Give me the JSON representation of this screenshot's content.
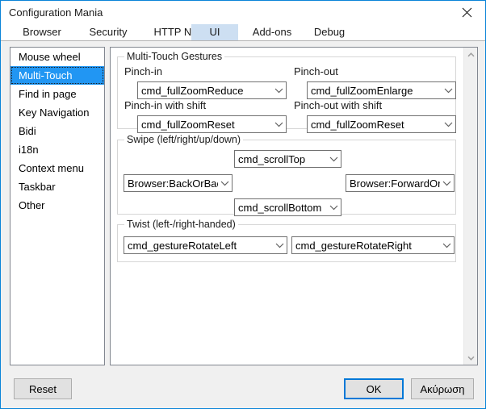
{
  "window": {
    "title": "Configuration Mania",
    "close_icon": "close-icon"
  },
  "tabs": [
    {
      "label": "Browser",
      "selected": false
    },
    {
      "label": "Security",
      "selected": false
    },
    {
      "label": "HTTP Network",
      "selected": false
    },
    {
      "label": "UI",
      "selected": true
    },
    {
      "label": "Add-ons",
      "selected": false
    },
    {
      "label": "Debug",
      "selected": false
    }
  ],
  "sidebar": {
    "items": [
      {
        "label": "Mouse wheel",
        "selected": false
      },
      {
        "label": "Multi-Touch",
        "selected": true
      },
      {
        "label": "Find in page",
        "selected": false
      },
      {
        "label": "Key Navigation",
        "selected": false
      },
      {
        "label": "Bidi",
        "selected": false
      },
      {
        "label": "i18n",
        "selected": false
      },
      {
        "label": "Context menu",
        "selected": false
      },
      {
        "label": "Taskbar",
        "selected": false
      },
      {
        "label": "Other",
        "selected": false
      }
    ]
  },
  "main": {
    "groups": {
      "gestures": {
        "title": "Multi-Touch Gestures",
        "fields": {
          "pinch_in": {
            "label": "Pinch-in",
            "value": "cmd_fullZoomReduce"
          },
          "pinch_out": {
            "label": "Pinch-out",
            "value": "cmd_fullZoomEnlarge"
          },
          "pinch_in_shift": {
            "label": "Pinch-in with shift",
            "value": "cmd_fullZoomReset"
          },
          "pinch_out_shift": {
            "label": "Pinch-out with shift",
            "value": "cmd_fullZoomReset"
          }
        }
      },
      "swipe": {
        "title": "Swipe (left/right/up/down)",
        "fields": {
          "up": {
            "value": "cmd_scrollTop"
          },
          "left": {
            "value": "Browser:BackOrBackI"
          },
          "right": {
            "value": "Browser:ForwardOrFo"
          },
          "down": {
            "value": "cmd_scrollBottom"
          }
        }
      },
      "twist": {
        "title": "Twist (left-/right-handed)",
        "fields": {
          "left_handed": {
            "value": "cmd_gestureRotateLeft"
          },
          "right_handed": {
            "value": "cmd_gestureRotateRight"
          }
        }
      }
    },
    "scrollbar": {
      "up_icon": "chevron-up-icon",
      "down_icon": "chevron-down-icon"
    }
  },
  "footer": {
    "reset_label": "Reset",
    "ok_label": "OK",
    "cancel_label": "Ακύρωση"
  },
  "colors": {
    "accent": "#0078d7",
    "selection": "#2196f3",
    "tab_selected": "#cddff2",
    "dialog_bg": "#f0f0f0",
    "border": "#828790"
  }
}
